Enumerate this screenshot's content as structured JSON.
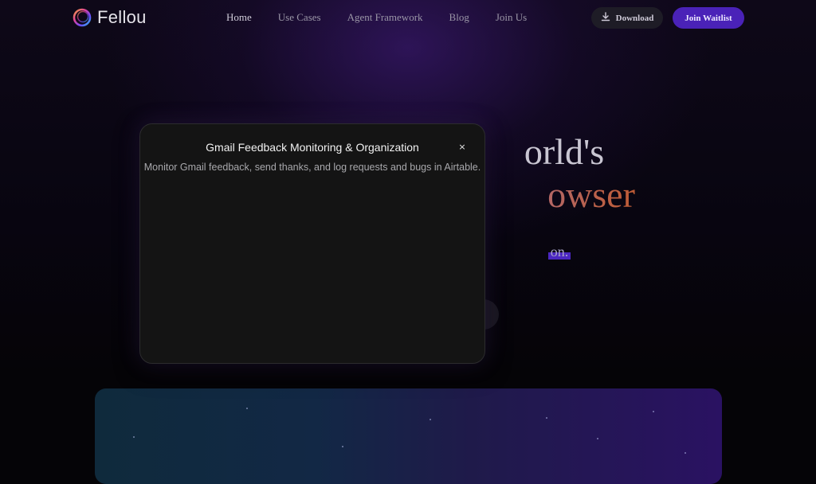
{
  "brand": {
    "name": "Fellou",
    "logo_icon": "ring-logo-icon"
  },
  "nav": {
    "links": [
      {
        "label": "Home",
        "active": true
      },
      {
        "label": "Use Cases"
      },
      {
        "label": "Agent Framework"
      },
      {
        "label": "Blog"
      },
      {
        "label": "Join Us"
      }
    ],
    "download_label": "Download",
    "download_icon": "download-icon",
    "waitlist_label": "Join Waitlist"
  },
  "hero": {
    "line1_visible": "orld's",
    "line2_visible": "owser",
    "subtitle_visible": "on."
  },
  "modal": {
    "title": "Gmail Feedback Monitoring & Organization",
    "description": "Monitor Gmail feedback, send thanks, and log requests and bugs in Airtable.",
    "close_label": "×"
  },
  "colors": {
    "accent": "#4a22b8",
    "highlight": "#4b27c2",
    "modal_bg": "#141414"
  }
}
